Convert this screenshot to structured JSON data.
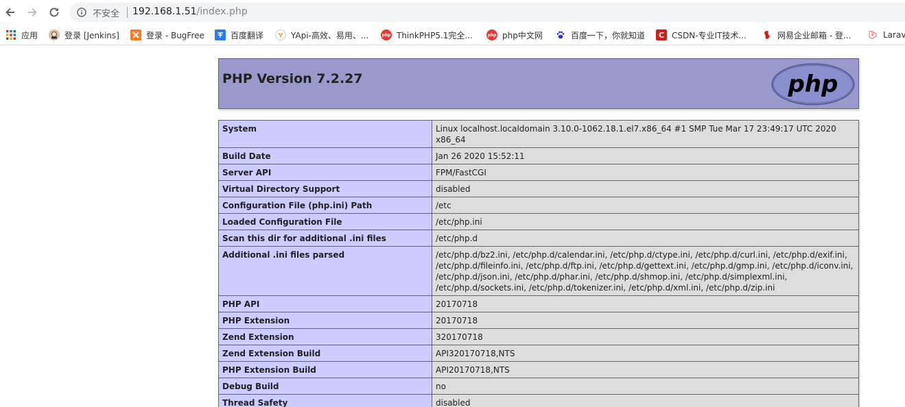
{
  "browser": {
    "security_status": "不安全",
    "url_host": "192.168.1.51",
    "url_path": "/index.php"
  },
  "bookmarks": [
    {
      "label": "应用",
      "icon": "apps-grid-icon"
    },
    {
      "label": "登录 [Jenkins]",
      "icon": "jenkins-icon"
    },
    {
      "label": "登录 - BugFree",
      "icon": "bugfree-icon"
    },
    {
      "label": "百度翻译",
      "icon": "baidu-translate-icon"
    },
    {
      "label": "YApi-高效、易用、...",
      "icon": "yapi-icon"
    },
    {
      "label": "ThinkPHP5.1完全...",
      "icon": "php-cn-icon"
    },
    {
      "label": "php中文网",
      "icon": "php-cn-icon"
    },
    {
      "label": "百度一下，你就知道",
      "icon": "baidu-paw-icon"
    },
    {
      "label": "CSDN-专业IT技术...",
      "icon": "csdn-icon"
    },
    {
      "label": "网易企业邮箱 - 登...",
      "icon": "netease-icon"
    },
    {
      "label": "Larav",
      "icon": "laravel-icon"
    }
  ],
  "php": {
    "title": "PHP Version 7.2.27",
    "logo_text": "php",
    "rows": [
      {
        "key": "System",
        "value": "Linux localhost.localdomain 3.10.0-1062.18.1.el7.x86_64 #1 SMP Tue Mar 17 23:49:17 UTC 2020 x86_64"
      },
      {
        "key": "Build Date",
        "value": "Jan 26 2020 15:52:11"
      },
      {
        "key": "Server API",
        "value": "FPM/FastCGI"
      },
      {
        "key": "Virtual Directory Support",
        "value": "disabled"
      },
      {
        "key": "Configuration File (php.ini) Path",
        "value": "/etc"
      },
      {
        "key": "Loaded Configuration File",
        "value": "/etc/php.ini"
      },
      {
        "key": "Scan this dir for additional .ini files",
        "value": "/etc/php.d"
      },
      {
        "key": "Additional .ini files parsed",
        "value": "/etc/php.d/bz2.ini, /etc/php.d/calendar.ini, /etc/php.d/ctype.ini, /etc/php.d/curl.ini, /etc/php.d/exif.ini, /etc/php.d/fileinfo.ini, /etc/php.d/ftp.ini, /etc/php.d/gettext.ini, /etc/php.d/gmp.ini, /etc/php.d/iconv.ini, /etc/php.d/json.ini, /etc/php.d/phar.ini, /etc/php.d/shmop.ini, /etc/php.d/simplexml.ini, /etc/php.d/sockets.ini, /etc/php.d/tokenizer.ini, /etc/php.d/xml.ini, /etc/php.d/zip.ini"
      },
      {
        "key": "PHP API",
        "value": "20170718"
      },
      {
        "key": "PHP Extension",
        "value": "20170718"
      },
      {
        "key": "Zend Extension",
        "value": "320170718"
      },
      {
        "key": "Zend Extension Build",
        "value": "API320170718,NTS"
      },
      {
        "key": "PHP Extension Build",
        "value": "API20170718,NTS"
      },
      {
        "key": "Debug Build",
        "value": "no"
      },
      {
        "key": "Thread Safety",
        "value": "disabled"
      }
    ]
  }
}
